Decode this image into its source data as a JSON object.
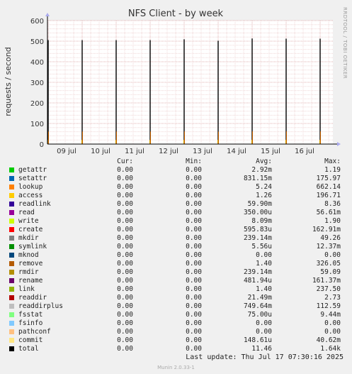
{
  "chart_data": {
    "type": "line",
    "title": "NFS Client - by week",
    "ylabel": "requests / second",
    "side_label": "RRDTOOL / TOBI OETIKER",
    "ylim": [
      0,
      600
    ],
    "yticks": [
      0,
      100,
      200,
      300,
      400,
      500,
      600
    ],
    "x_ticks": [
      "09 jul",
      "10 jul",
      "11 jul",
      "12 jul",
      "13 jul",
      "14 jul",
      "15 jul",
      "16 jul"
    ],
    "spikes": [
      {
        "day": 0.0,
        "value": 505
      },
      {
        "day": 1.0,
        "value": 505
      },
      {
        "day": 2.0,
        "value": 505
      },
      {
        "day": 3.0,
        "value": 505
      },
      {
        "day": 4.0,
        "value": 509
      },
      {
        "day": 5.0,
        "value": 502
      },
      {
        "day": 6.0,
        "value": 513
      },
      {
        "day": 7.0,
        "value": 512
      },
      {
        "day": 8.0,
        "value": 512
      }
    ],
    "grid": true
  },
  "legend": {
    "headers": {
      "cur": "Cur:",
      "min": "Min:",
      "avg": "Avg:",
      "max": "Max:"
    },
    "rows": [
      {
        "name": "getattr",
        "color": "#00cc00",
        "cur": "0.00",
        "min": "0.00",
        "avg": "2.92m",
        "max": "1.19"
      },
      {
        "name": "setattr",
        "color": "#0066b3",
        "cur": "0.00",
        "min": "0.00",
        "avg": "831.15m",
        "max": "175.97"
      },
      {
        "name": "lookup",
        "color": "#ff8000",
        "cur": "0.00",
        "min": "0.00",
        "avg": "5.24",
        "max": "662.14"
      },
      {
        "name": "access",
        "color": "#ffcc00",
        "cur": "0.00",
        "min": "0.00",
        "avg": "1.26",
        "max": "196.71"
      },
      {
        "name": "readlink",
        "color": "#330099",
        "cur": "0.00",
        "min": "0.00",
        "avg": "59.90m",
        "max": "8.36"
      },
      {
        "name": "read",
        "color": "#990099",
        "cur": "0.00",
        "min": "0.00",
        "avg": "350.00u",
        "max": "56.61m"
      },
      {
        "name": "write",
        "color": "#ccff00",
        "cur": "0.00",
        "min": "0.00",
        "avg": "8.09m",
        "max": "1.90"
      },
      {
        "name": "create",
        "color": "#ff0000",
        "cur": "0.00",
        "min": "0.00",
        "avg": "595.83u",
        "max": "162.91m"
      },
      {
        "name": "mkdir",
        "color": "#808080",
        "cur": "0.00",
        "min": "0.00",
        "avg": "239.14m",
        "max": "49.26"
      },
      {
        "name": "symlink",
        "color": "#008f00",
        "cur": "0.00",
        "min": "0.00",
        "avg": "5.56u",
        "max": "12.37m"
      },
      {
        "name": "mknod",
        "color": "#00487d",
        "cur": "0.00",
        "min": "0.00",
        "avg": "0.00",
        "max": "0.00"
      },
      {
        "name": "remove",
        "color": "#b35a00",
        "cur": "0.00",
        "min": "0.00",
        "avg": "1.40",
        "max": "326.05"
      },
      {
        "name": "rmdir",
        "color": "#b38f00",
        "cur": "0.00",
        "min": "0.00",
        "avg": "239.14m",
        "max": "59.09"
      },
      {
        "name": "rename",
        "color": "#6b006b",
        "cur": "0.00",
        "min": "0.00",
        "avg": "481.94u",
        "max": "161.37m"
      },
      {
        "name": "link",
        "color": "#8fb300",
        "cur": "0.00",
        "min": "0.00",
        "avg": "1.40",
        "max": "237.50"
      },
      {
        "name": "readdir",
        "color": "#b30000",
        "cur": "0.00",
        "min": "0.00",
        "avg": "21.49m",
        "max": "2.73"
      },
      {
        "name": "readdirplus",
        "color": "#bebebe",
        "cur": "0.00",
        "min": "0.00",
        "avg": "749.64m",
        "max": "112.59"
      },
      {
        "name": "fsstat",
        "color": "#80ff80",
        "cur": "0.00",
        "min": "0.00",
        "avg": "75.00u",
        "max": "9.44m"
      },
      {
        "name": "fsinfo",
        "color": "#80c9ff",
        "cur": "0.00",
        "min": "0.00",
        "avg": "0.00",
        "max": "0.00"
      },
      {
        "name": "pathconf",
        "color": "#ffc080",
        "cur": "0.00",
        "min": "0.00",
        "avg": "0.00",
        "max": "0.00"
      },
      {
        "name": "commit",
        "color": "#ffe680",
        "cur": "0.00",
        "min": "0.00",
        "avg": "148.61u",
        "max": "40.62m"
      },
      {
        "name": "total",
        "color": "#000000",
        "cur": "0.00",
        "min": "0.00",
        "avg": "11.46",
        "max": "1.64k"
      }
    ]
  },
  "footer": {
    "last_update": "Last update: Thu Jul 17 07:30:16 2025",
    "munin": "Munin 2.0.33-1"
  }
}
